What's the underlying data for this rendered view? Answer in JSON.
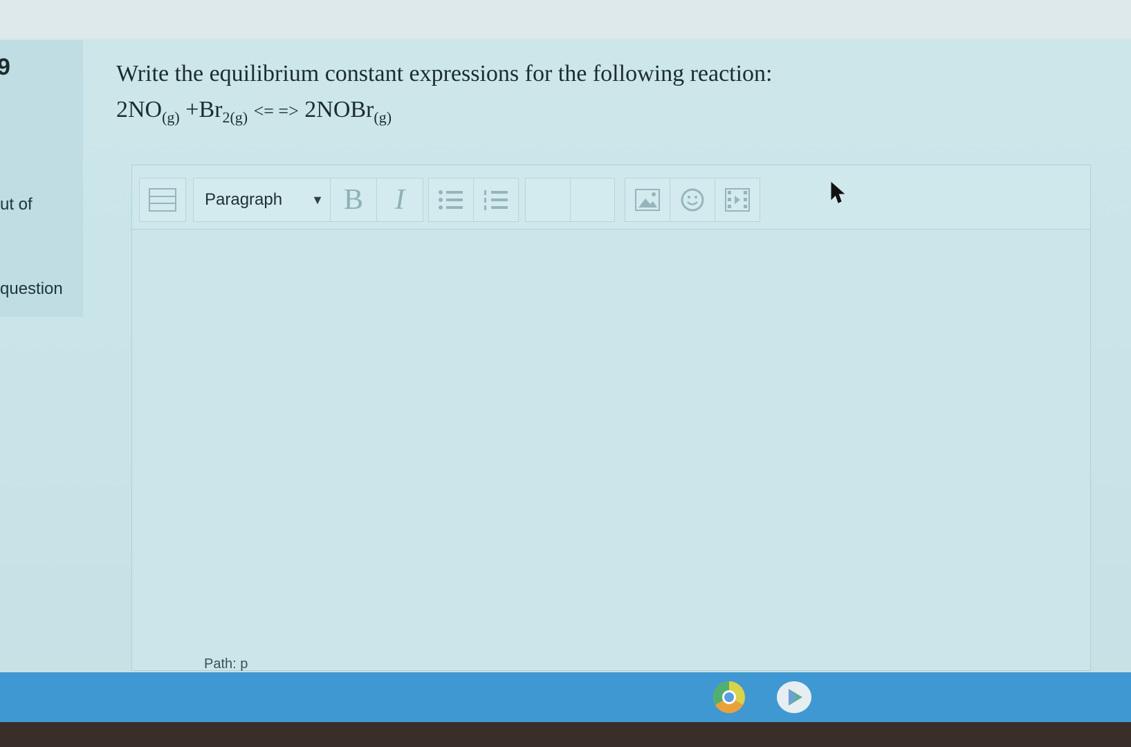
{
  "sidebar": {
    "question_number": "9",
    "text_1": "ut of",
    "text_2": "question"
  },
  "question": {
    "prompt": "Write the equilibrium constant expressions for the following reaction:",
    "reaction": {
      "reactant1": "2NO",
      "reactant1_state": "(g)",
      "plus": "+Br",
      "reactant2_state": "2(g)",
      "arrow": "<= =>",
      "product": "2NOBr",
      "product_state": "(g)"
    }
  },
  "editor": {
    "format_select": "Paragraph",
    "bold_label": "B",
    "italic_label": "I",
    "path_text": "Path: p",
    "icons": [
      "toolbar-toggle-icon",
      "unordered-list-icon",
      "ordered-list-icon",
      "image-icon",
      "emoji-icon",
      "media-icon"
    ]
  },
  "taskbar": {
    "apps": [
      "chrome-icon",
      "play-store-icon"
    ]
  },
  "colors": {
    "taskbar": "#3f98d2",
    "text": "#1b2c30",
    "toolbar_icon": "#8fb0b6"
  }
}
